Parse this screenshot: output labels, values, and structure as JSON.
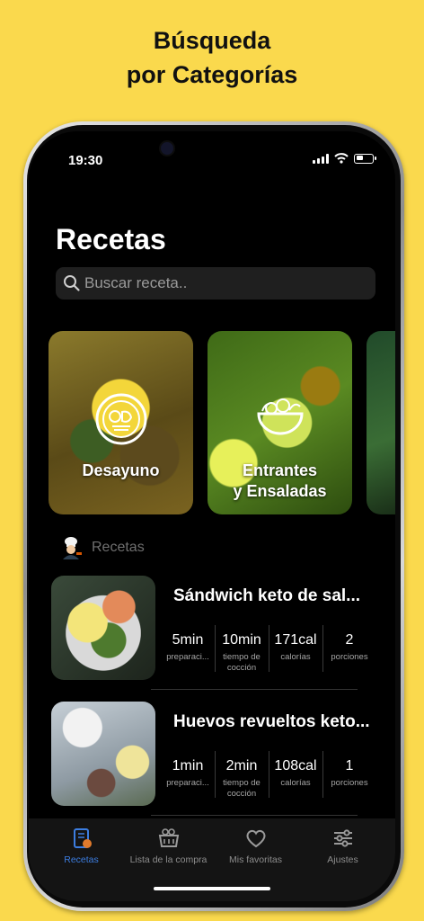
{
  "promo": {
    "line1": "Búsqueda",
    "line2": "por Categorías"
  },
  "status": {
    "time": "19:30"
  },
  "page": {
    "title": "Recetas"
  },
  "search": {
    "placeholder": "Buscar receta.."
  },
  "categories": [
    {
      "label": "Desayuno"
    },
    {
      "label": "Entrantes\ny Ensaladas"
    }
  ],
  "section": {
    "title": "Recetas"
  },
  "recipes": [
    {
      "name": "Sándwich keto de sal...",
      "stats": [
        {
          "value": "5min",
          "label": "preparaci..."
        },
        {
          "value": "10min",
          "label": "tiempo de cocción"
        },
        {
          "value": "171cal",
          "label": "calorías"
        },
        {
          "value": "2",
          "label": "porciones"
        }
      ]
    },
    {
      "name": "Huevos revueltos keto...",
      "stats": [
        {
          "value": "1min",
          "label": "preparaci..."
        },
        {
          "value": "2min",
          "label": "tiempo de cocción"
        },
        {
          "value": "108cal",
          "label": "calorías"
        },
        {
          "value": "1",
          "label": "porciones"
        }
      ]
    }
  ],
  "tabs": [
    {
      "label": "Recetas",
      "icon": "recipe-book-icon",
      "active": true
    },
    {
      "label": "Lista de la compra",
      "icon": "shopping-basket-icon"
    },
    {
      "label": "Mis favoritas",
      "icon": "heart-icon"
    },
    {
      "label": "Ajustes",
      "icon": "sliders-icon"
    }
  ],
  "colors": {
    "background": "#fad94d",
    "accent": "#3c7de0",
    "screen": "#000000"
  }
}
